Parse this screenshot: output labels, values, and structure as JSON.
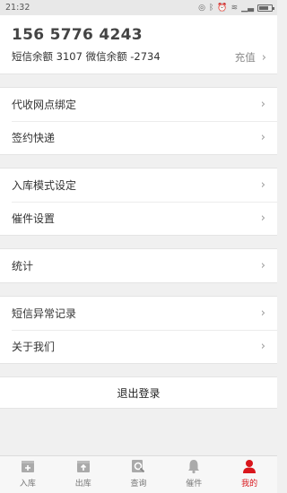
{
  "status_bar": {
    "time": "21:32"
  },
  "account": {
    "phone": "156 5776 4243",
    "balance": "短信余额 3107 微信余额 -2734",
    "recharge_label": "充值"
  },
  "menu_groups": [
    {
      "items": [
        "代收网点绑定",
        "签约快递"
      ]
    },
    {
      "items": [
        "入库模式设定",
        "催件设置"
      ]
    },
    {
      "items": [
        "统计"
      ]
    },
    {
      "items": [
        "短信异常记录",
        "关于我们"
      ]
    }
  ],
  "logout_label": "退出登录",
  "tabs": [
    {
      "label": "入库",
      "icon": "inbox-box-icon",
      "active": false
    },
    {
      "label": "出库",
      "icon": "outbox-box-icon",
      "active": false
    },
    {
      "label": "查询",
      "icon": "search-doc-icon",
      "active": false
    },
    {
      "label": "催件",
      "icon": "bell-icon",
      "active": false
    },
    {
      "label": "我的",
      "icon": "user-icon",
      "active": true
    }
  ],
  "colors": {
    "accent": "#d9161c",
    "inactive_icon": "#aaaaaa"
  }
}
